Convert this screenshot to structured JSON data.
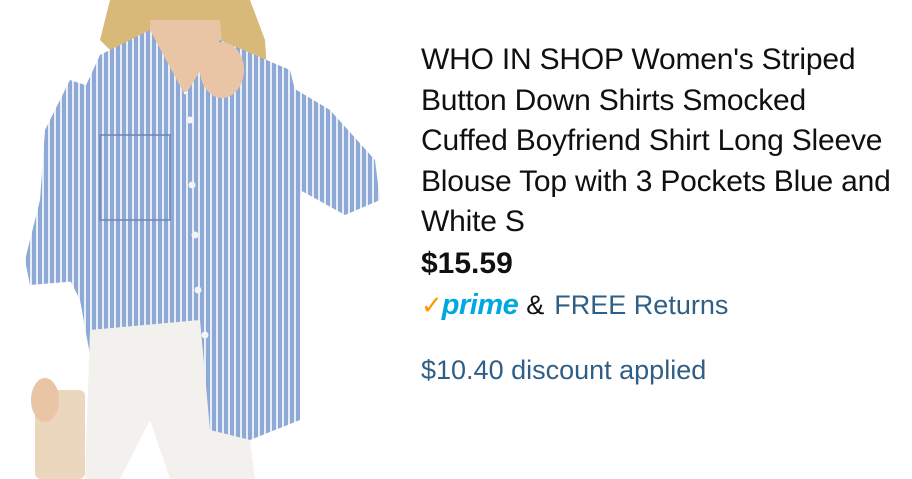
{
  "product": {
    "image_alt": "Woman wearing blue and white striped button down shirt",
    "title": "WHO IN SHOP Women's Striped Button Down Shirts Smocked Cuffed Boyfriend Shirt Long Sleeve Blouse Top with 3 Pockets Blue and White S",
    "price": "$15.59",
    "prime_label": "prime",
    "prime_check": "✓",
    "amp": "&",
    "returns": "FREE Returns",
    "discount": "$10.40 discount applied"
  },
  "colors": {
    "prime_blue": "#00a8e1",
    "prime_check": "#ff9900",
    "link_blue": "#2f5f86",
    "text": "#0f1111"
  }
}
